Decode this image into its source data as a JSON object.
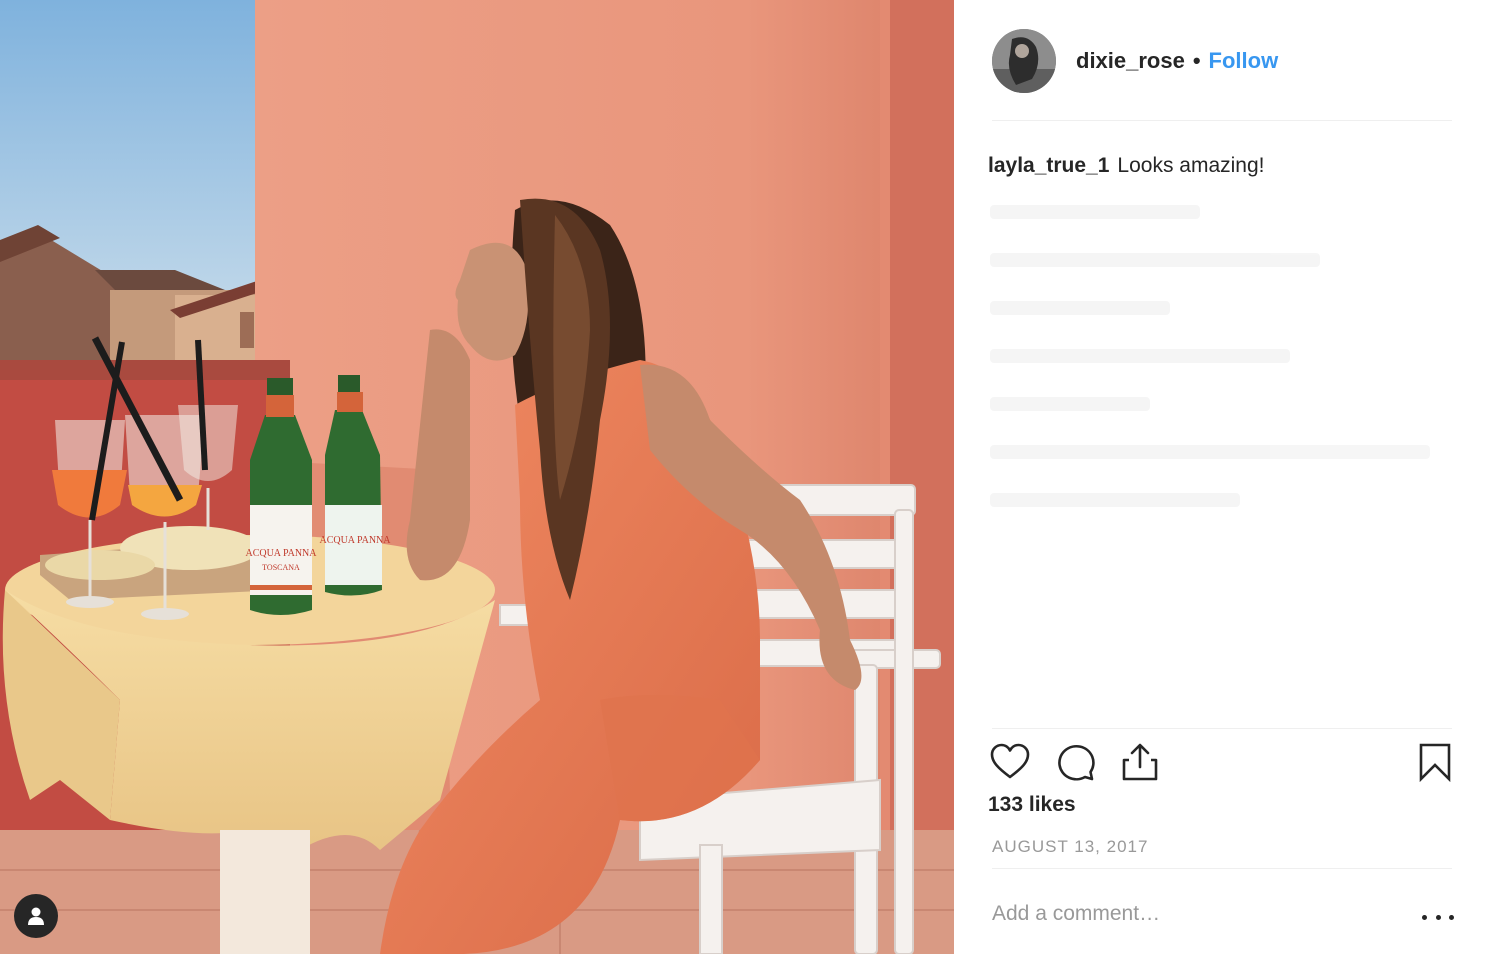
{
  "post": {
    "author": {
      "username": "dixie_rose",
      "separator": "•",
      "follow_label": "Follow"
    },
    "comments": [
      {
        "author": "layla_true_1",
        "text": "Looks amazing!"
      }
    ],
    "likes_text": "133 likes",
    "date": "AUGUST 13, 2017",
    "add_comment_placeholder": "Add a comment…"
  },
  "bottle": {
    "brand": "ACQUA PANNA",
    "sub": "TOSCANA"
  },
  "icons": {
    "like": "heart-icon",
    "comment": "speech-bubble-icon",
    "share": "share-icon",
    "save": "bookmark-icon",
    "more": "more-dots-icon",
    "tagged": "person-icon"
  },
  "colors": {
    "follow": "#3897f0",
    "text": "#262626",
    "muted": "#999999",
    "divider": "#efefef"
  }
}
